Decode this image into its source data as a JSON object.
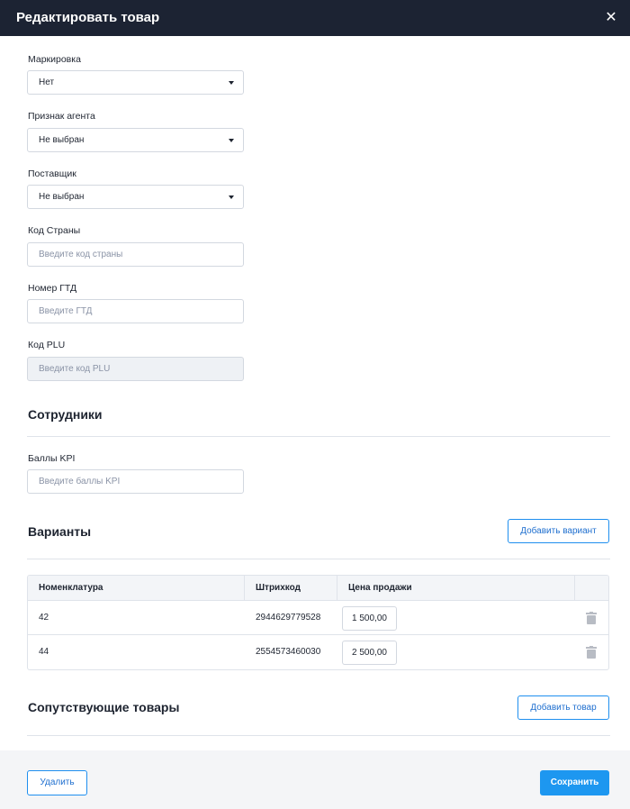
{
  "dialog": {
    "title": "Редактировать товар",
    "close_icon": "close-icon"
  },
  "form": {
    "marking": {
      "label": "Маркировка",
      "value": "Нет"
    },
    "agent_sign": {
      "label": "Признак агента",
      "value": "Не выбран"
    },
    "supplier": {
      "label": "Поставщик",
      "value": "Не выбран"
    },
    "country_code": {
      "label": "Код Страны",
      "placeholder": "Введите код страны"
    },
    "gtd_number": {
      "label": "Номер ГТД",
      "placeholder": "Введите ГТД"
    },
    "plu_code": {
      "label": "Код PLU",
      "placeholder": "Введите код PLU"
    }
  },
  "employees": {
    "title": "Сотрудники",
    "kpi": {
      "label": "Баллы KPI",
      "placeholder": "Введите баллы KPI"
    }
  },
  "variants": {
    "title": "Варианты",
    "add_button": "Добавить вариант",
    "columns": [
      "Номенклатура",
      "Штрихкод",
      "Цена продажи"
    ],
    "rows": [
      {
        "name": "42",
        "barcode": "2944629779528",
        "price": "1 500,00"
      },
      {
        "name": "44",
        "barcode": "2554573460030",
        "price": "2 500,00"
      }
    ]
  },
  "related": {
    "title": "Сопутствующие товары",
    "add_button": "Добавить товар"
  },
  "footer": {
    "delete_button": "Удалить",
    "save_button": "Сохранить"
  },
  "colors": {
    "header_bg": "#1c2333",
    "accent": "#1d97f0",
    "border": "#d3d8e0"
  }
}
